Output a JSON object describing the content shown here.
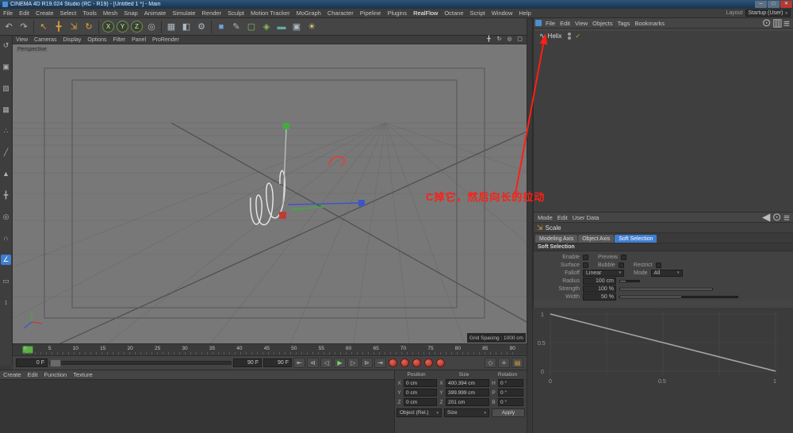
{
  "window": {
    "title": "CINEMA 4D R19.024 Studio (RC - R19) - [Untitled 1 *] - Main",
    "minimize": "─",
    "maximize": "□",
    "close": "✕"
  },
  "menubar": {
    "items": [
      "File",
      "Edit",
      "Create",
      "Select",
      "Tools",
      "Mesh",
      "Snap",
      "Animate",
      "Simulate",
      "Render",
      "Sculpt",
      "Motion Tracker",
      "MoGraph",
      "Character",
      "Pipeline",
      "Plugins",
      "RealFlow",
      "Octane",
      "Script",
      "Window",
      "Help"
    ],
    "layout_label": "Layout",
    "layout_value": "Startup (User)"
  },
  "toolbar": {
    "icons": [
      {
        "name": "undo",
        "glyph": "↶"
      },
      {
        "name": "redo",
        "glyph": "↷"
      },
      {
        "name": "live-selection",
        "glyph": "↖"
      },
      {
        "name": "move",
        "glyph": "╋"
      },
      {
        "name": "scale",
        "glyph": "⇲"
      },
      {
        "name": "rotate",
        "glyph": "↻"
      },
      {
        "name": "lock-x",
        "glyph": "X"
      },
      {
        "name": "lock-y",
        "glyph": "Y"
      },
      {
        "name": "lock-z",
        "glyph": "Z"
      },
      {
        "name": "coordinate-system",
        "glyph": "◎"
      },
      {
        "name": "render-view",
        "glyph": "▦"
      },
      {
        "name": "render-region",
        "glyph": "◧"
      },
      {
        "name": "render-settings",
        "glyph": "⚙"
      },
      {
        "name": "add-cube",
        "glyph": "■"
      },
      {
        "name": "add-spline",
        "glyph": "✎"
      },
      {
        "name": "subdivision-surface",
        "glyph": "▢"
      },
      {
        "name": "add-generator",
        "glyph": "◈"
      },
      {
        "name": "add-floor",
        "glyph": "▬"
      },
      {
        "name": "add-camera",
        "glyph": "▣"
      },
      {
        "name": "add-light",
        "glyph": "☀"
      }
    ]
  },
  "left_toolbar": {
    "tools": [
      {
        "name": "make-editable",
        "glyph": "↺"
      },
      {
        "name": "model-mode",
        "glyph": "▣"
      },
      {
        "name": "texture-mode",
        "glyph": "▨"
      },
      {
        "name": "workplane-mode",
        "glyph": "▦"
      },
      {
        "name": "points-mode",
        "glyph": "∴"
      },
      {
        "name": "edges-mode",
        "glyph": "╱"
      },
      {
        "name": "polygons-mode",
        "glyph": "▲"
      },
      {
        "name": "enable-axis",
        "glyph": "╋"
      },
      {
        "name": "viewport-solo",
        "glyph": "◎"
      },
      {
        "name": "snap-enable",
        "glyph": "∩"
      },
      {
        "name": "quantize-enable",
        "glyph": "∠"
      },
      {
        "name": "workplane-lock",
        "glyph": "▭"
      },
      {
        "name": "measure-tool",
        "glyph": "↕"
      }
    ]
  },
  "viewport": {
    "menus": [
      "View",
      "Cameras",
      "Display",
      "Options",
      "Filter",
      "Panel",
      "ProRender"
    ],
    "label": "Perspective",
    "grid_spacing": "Grid Spacing : 1000 cm",
    "nav_icons": [
      {
        "name": "pan",
        "glyph": "╋"
      },
      {
        "name": "orbit",
        "glyph": "↻"
      },
      {
        "name": "zoom",
        "glyph": "◎"
      },
      {
        "name": "maximize-view",
        "glyph": "▢"
      }
    ]
  },
  "annotation": {
    "text": "C掉它，然后向长的拉动",
    "color": "#ff1f14"
  },
  "objects_panel": {
    "menus": [
      "File",
      "Edit",
      "View",
      "Objects",
      "Tags",
      "Bookmarks"
    ],
    "corner_icons": [
      {
        "name": "search",
        "glyph": "⊙"
      },
      {
        "name": "filter",
        "glyph": "▥"
      },
      {
        "name": "options",
        "glyph": "≡"
      }
    ],
    "item": {
      "label": "Helix",
      "icon_glyph": "∿",
      "check": "✓"
    }
  },
  "attributes_panel": {
    "menus": [
      "Mode",
      "Edit",
      "User Data"
    ],
    "corner_icons": [
      {
        "name": "history-back",
        "glyph": "◀"
      },
      {
        "name": "search",
        "glyph": "⊙"
      },
      {
        "name": "options",
        "glyph": "≡"
      }
    ],
    "tool_icon_glyph": "⇲",
    "tool_label": "Scale",
    "tabs": [
      "Modeling Axis",
      "Object Axis",
      "Soft Selection"
    ],
    "active_tab": "Soft Selection",
    "section_title": "Soft Selection",
    "params": {
      "enable": "Enable",
      "preview": "Preview",
      "surface": "Surface",
      "bubble": "Bubble",
      "restrict": "Restrict",
      "falloff_label": "Falloff",
      "falloff_value": "Linear",
      "mode_label": "Mode",
      "mode_value": "All",
      "radius_label": "Radius",
      "radius_value": "100 cm",
      "strength_label": "Strength",
      "strength_value": "100 %",
      "width_label": "Width",
      "width_value": "50 %"
    },
    "graph": {
      "y_ticks": [
        "1",
        "0.5",
        "0"
      ],
      "x_ticks": [
        "0",
        "0.5",
        "1"
      ]
    }
  },
  "timeline": {
    "ticks": [
      "0",
      "5",
      "10",
      "15",
      "20",
      "25",
      "30",
      "35",
      "40",
      "45",
      "50",
      "55",
      "60",
      "65",
      "70",
      "75",
      "80",
      "85",
      "90"
    ],
    "current_frame": "0"
  },
  "transport": {
    "start_field": "0 F",
    "end_field": "90 F",
    "current_field": "90 F",
    "buttons": [
      {
        "name": "goto-start",
        "glyph": "⇤"
      },
      {
        "name": "prev-key",
        "glyph": "⊲"
      },
      {
        "name": "prev-frame",
        "glyph": "◁"
      },
      {
        "name": "play",
        "glyph": "▶"
      },
      {
        "name": "next-frame",
        "glyph": "▷"
      },
      {
        "name": "next-key",
        "glyph": "⊳"
      },
      {
        "name": "goto-end",
        "glyph": "⇥"
      }
    ],
    "record_buttons": [
      {
        "name": "record-keyframe"
      },
      {
        "name": "autokeying"
      },
      {
        "name": "record-position"
      },
      {
        "name": "record-scale"
      },
      {
        "name": "record-rotation"
      }
    ],
    "right_icons": [
      {
        "name": "keyframe-selection",
        "glyph": "◇"
      },
      {
        "name": "playback-options",
        "glyph": "≡"
      },
      {
        "name": "timeline-options",
        "glyph": "▤"
      }
    ]
  },
  "material_panel": {
    "menus": [
      "Create",
      "Edit",
      "Function",
      "Texture"
    ]
  },
  "coordinates": {
    "columns": [
      "Position",
      "Size",
      "Rotation"
    ],
    "rows": [
      {
        "pl": "X",
        "pv": "0 cm",
        "sl": "X",
        "sv": "400.394 cm",
        "rl": "H",
        "rv": "0 °"
      },
      {
        "pl": "Y",
        "pv": "0 cm",
        "sl": "Y",
        "sv": "399.999 cm",
        "rl": "P",
        "rv": "0 °"
      },
      {
        "pl": "Z",
        "pv": "0 cm",
        "sl": "Z",
        "sv": "201 cm",
        "rl": "B",
        "rv": "0 °"
      }
    ],
    "object_mode": "Object (Rel.)",
    "size_mode": "Size",
    "apply_label": "Apply"
  },
  "colors": {
    "annotation": "#ff1f14",
    "tab_active": "#3f7fd2",
    "axis_x": "#c23b33",
    "axis_y": "#3fae3a",
    "axis_z": "#3a56c9"
  }
}
